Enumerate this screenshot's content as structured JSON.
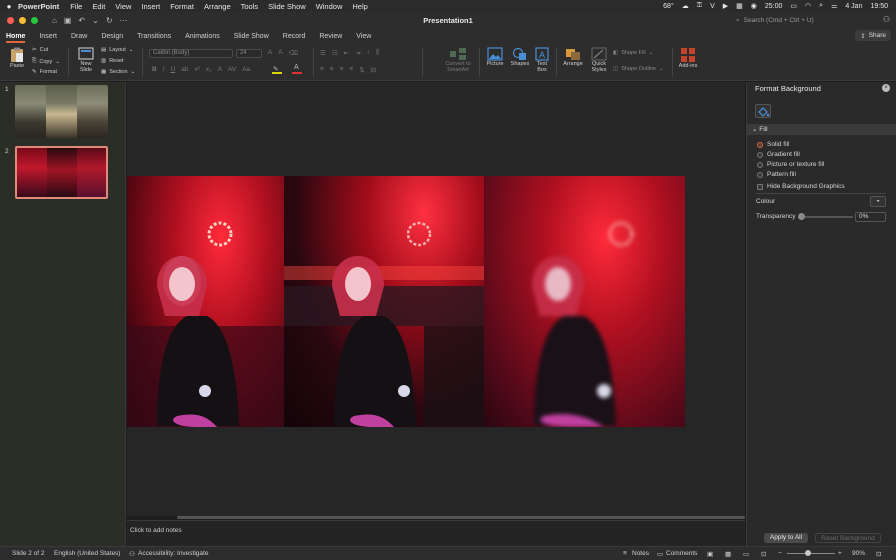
{
  "menubar": {
    "app": "PowerPoint",
    "menus": [
      "File",
      "Edit",
      "View",
      "Insert",
      "Format",
      "Arrange",
      "Tools",
      "Slide Show",
      "Window",
      "Help"
    ],
    "temperature": "68°",
    "letter": "V",
    "time_clock": "25:00",
    "date": "4 Jan",
    "time": "19:50"
  },
  "titlebar": {
    "title": "Presentation1",
    "search_placeholder": "Search (Cmd + Ctrl + U)"
  },
  "tabs": [
    "Home",
    "Insert",
    "Draw",
    "Design",
    "Transitions",
    "Animations",
    "Slide Show",
    "Record",
    "Review",
    "View"
  ],
  "active_tab": "Home",
  "share_label": "Share",
  "ribbon": {
    "paste": "Paste",
    "cut": "Cut",
    "copy": "Copy",
    "format": "Format",
    "new_slide_1": "New",
    "new_slide_2": "Slide",
    "layout": "Layout",
    "reset": "Reset",
    "section": "Section",
    "font_name": "Calibri (Body)",
    "font_size": "24",
    "convert_1": "Convert to",
    "convert_2": "SmartArt",
    "picture": "Picture",
    "shapes": "Shapes",
    "text_box_1": "Text",
    "text_box_2": "Box",
    "arrange": "Arrange",
    "quick_styles_1": "Quick",
    "quick_styles_2": "Styles",
    "shape_fill": "Shape Fill",
    "shape_outline": "Shape Outline",
    "addins": "Add-ins"
  },
  "slides_panel": {
    "slides": [
      {
        "number": "1"
      },
      {
        "number": "2"
      }
    ]
  },
  "notes_placeholder": "Click to add notes",
  "format_pane": {
    "title": "Format Background",
    "section": "Fill",
    "options": [
      "Solid fill",
      "Gradient fill",
      "Picture or texture fill",
      "Pattern fill"
    ],
    "selected_option": "Solid fill",
    "hide_graphics": "Hide Background Graphics",
    "colour_label": "Colour",
    "transparency_label": "Transparency",
    "transparency_value": "0%",
    "apply_all": "Apply to All",
    "reset_bg": "Reset Background"
  },
  "status": {
    "slide_info": "Slide 2 of 2",
    "language": "English (United States)",
    "accessibility": "Accessibility: Investigate",
    "notes": "Notes",
    "comments": "Comments",
    "zoom": "90%"
  },
  "colors": {
    "accent": "#e0663d",
    "background": "#1e1e1e",
    "panel": "#2d2d2d"
  }
}
